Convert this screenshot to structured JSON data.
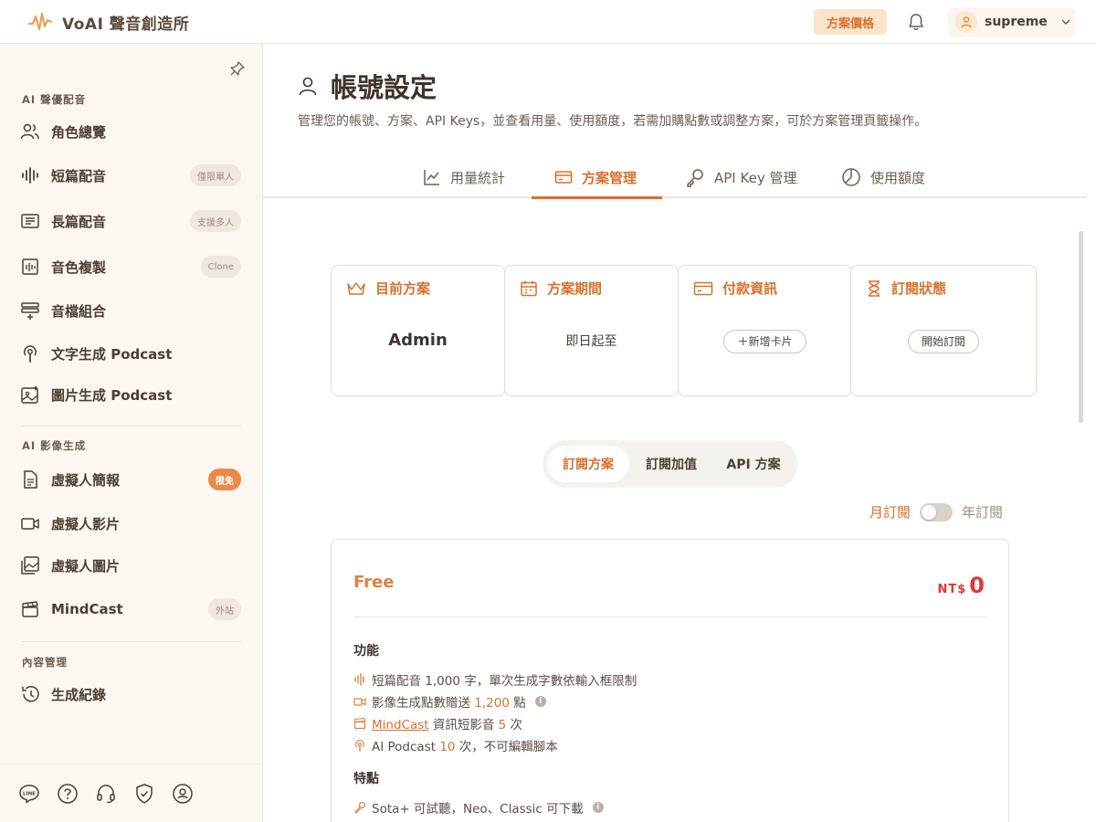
{
  "header": {
    "brand_name": "VoAI 聲音創造所",
    "pricing_label": "方案價格",
    "user_name": "supreme"
  },
  "sidebar": {
    "section_voice": "AI 聲優配音",
    "voice_items": [
      {
        "label": "角色總覽",
        "badge": ""
      },
      {
        "label": "短篇配音",
        "badge": "僅限單人"
      },
      {
        "label": "長篇配音",
        "badge": "支援多人"
      },
      {
        "label": "音色複製",
        "badge": "Clone"
      },
      {
        "label": "音檔組合",
        "badge": ""
      },
      {
        "label": "文字生成 Podcast",
        "badge": ""
      },
      {
        "label": "圖片生成 Podcast",
        "badge": ""
      }
    ],
    "section_video": "AI 影像生成",
    "video_items": [
      {
        "label": "虛擬人簡報",
        "badge": "限免"
      },
      {
        "label": "虛擬人影片",
        "badge": ""
      },
      {
        "label": "虛擬人圖片",
        "badge": ""
      },
      {
        "label": "MindCast",
        "badge": "外站"
      }
    ],
    "section_content": "內容管理",
    "content_items": [
      {
        "label": "生成紀錄"
      }
    ],
    "footer_icons": [
      "line-icon",
      "help-icon",
      "headset-icon",
      "shield-icon",
      "coin-icon"
    ]
  },
  "page": {
    "title": "帳號設定",
    "description": "管理您的帳號、方案、API Keys，並查看用量、使用額度，若需加購點數或調整方案，可於方案管理頁籤操作。",
    "tabs": [
      {
        "label": "用量統計",
        "active": false
      },
      {
        "label": "方案管理",
        "active": true
      },
      {
        "label": "API Key 管理",
        "active": false
      },
      {
        "label": "使用額度",
        "active": false
      }
    ]
  },
  "cards": {
    "current_plan": {
      "title": "目前方案",
      "value": "Admin"
    },
    "plan_period": {
      "title": "方案期間",
      "value": "即日起至"
    },
    "payment": {
      "title": "付款資訊",
      "button": "＋新增卡片"
    },
    "subscription": {
      "title": "訂閱狀態",
      "button": "開始訂閱"
    }
  },
  "plan_switch": {
    "options": [
      "訂閱方案",
      "訂閱加值",
      "API 方案"
    ],
    "active": "訂閱方案"
  },
  "billing": {
    "monthly": "月訂閱",
    "yearly": "年訂閱",
    "yearly_selected": false
  },
  "plan": {
    "name": "Free",
    "currency": "NT$",
    "amount": "0",
    "features_title": "功能",
    "features": {
      "f1": "短篇配音 1,000 字，單次生成字數依輸入框限制",
      "f2_pre": "影像生成點數贈送 ",
      "f2_val": "1,200",
      "f2_post": " 點",
      "f3_link": "MindCast",
      "f3_mid": " 資訊短影音 ",
      "f3_val": "5",
      "f3_post": " 次",
      "f4_pre": "AI Podcast ",
      "f4_val": "10",
      "f4_post": " 次，不可編輯腳本"
    },
    "traits_title": "特點",
    "traits": {
      "t1": "Sota+ 可試聽，Neo、Classic 可下載"
    }
  },
  "colors": {
    "accent": "#d9702c",
    "price": "#e0353a",
    "sidebar_bg": "#fdf7f1"
  }
}
